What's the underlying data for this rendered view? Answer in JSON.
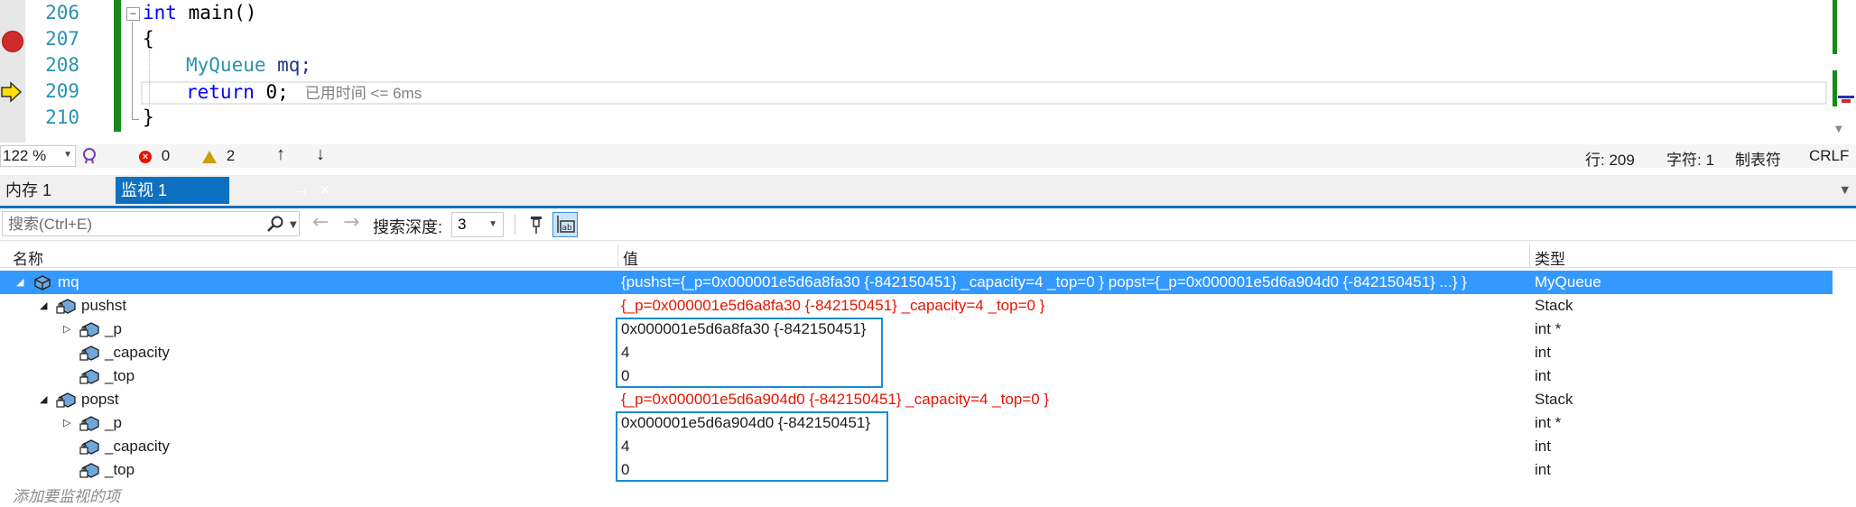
{
  "editor": {
    "line_numbers": [
      "206",
      "207",
      "208",
      "209",
      "210"
    ],
    "lines": {
      "l206_kw": "int",
      "l206_rest": " main()",
      "l207": "{",
      "l208_type": "MyQueue",
      "l208_rest": " mq;",
      "l209_kw": "return",
      "l209_num": " 0;",
      "l209_hint": "已用时间 <= 6ms",
      "l210": "}"
    }
  },
  "statusbar": {
    "zoom": "122 %",
    "errors": "0",
    "warnings": "2",
    "line": "行: 209",
    "col": "字符: 1",
    "indent": "制表符",
    "eol": "CRLF"
  },
  "tabs": {
    "memory": "内存 1",
    "watch": "监视 1"
  },
  "toolbar": {
    "search_placeholder": "搜索(Ctrl+E)",
    "depth_label": "搜索深度:",
    "depth_value": "3"
  },
  "grid": {
    "headers": {
      "name": "名称",
      "value": "值",
      "type": "类型"
    },
    "rows": [
      {
        "name": "mq",
        "value": "{pushst={_p=0x000001e5d6a8fa30 {-842150451} _capacity=4 _top=0 } popst={_p=0x000001e5d6a904d0 {-842150451} ...} }",
        "type": "MyQueue"
      },
      {
        "name": "pushst",
        "value": "{_p=0x000001e5d6a8fa30 {-842150451} _capacity=4 _top=0 }",
        "type": "Stack"
      },
      {
        "name": "_p",
        "value": "0x000001e5d6a8fa30 {-842150451}",
        "type": "int *"
      },
      {
        "name": "_capacity",
        "value": "4",
        "type": "int"
      },
      {
        "name": "_top",
        "value": "0",
        "type": "int"
      },
      {
        "name": "popst",
        "value": "{_p=0x000001e5d6a904d0 {-842150451} _capacity=4 _top=0 }",
        "type": "Stack"
      },
      {
        "name": "_p",
        "value": "0x000001e5d6a904d0 {-842150451}",
        "type": "int *"
      },
      {
        "name": "_capacity",
        "value": "4",
        "type": "int"
      },
      {
        "name": "_top",
        "value": "0",
        "type": "int"
      }
    ],
    "add_watch": "添加要监视的项"
  },
  "colors": {
    "accent": "#0e70c0",
    "selection": "#3399ff",
    "changed_value": "#e51400",
    "change_bar": "#168a1a"
  }
}
